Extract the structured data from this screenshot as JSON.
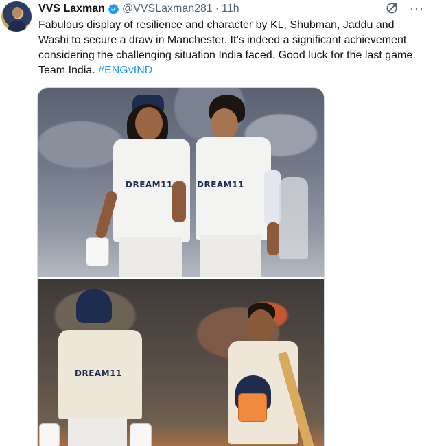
{
  "tweet": {
    "display_name": "VVS Laxman",
    "handle": "@VVSLaxman281",
    "separator": "·",
    "time": "11h",
    "text_main": "Fabulous display of resilience and character by KL, Shubman, Jaddu and Washi  to secure a draw in Manchester. It’s indeed a significant achievement considering the challenging situation India faced. Good luck for the last game Team India.",
    "hashtag": "#ENGvIND",
    "more_label": "···"
  },
  "media": {
    "top_sponsor_left": "DREAM11",
    "top_sponsor_right": "DREAM11",
    "bottom_sponsor_left": "DREAM11"
  },
  "colors": {
    "link": "#1d9bf0",
    "verified": "#1d9bf0",
    "secondary_text": "#536471",
    "primary_text": "#0f1419"
  },
  "icons": {
    "verified": "verified-badge-icon",
    "grok": "grok-icon",
    "more": "more-icon"
  }
}
